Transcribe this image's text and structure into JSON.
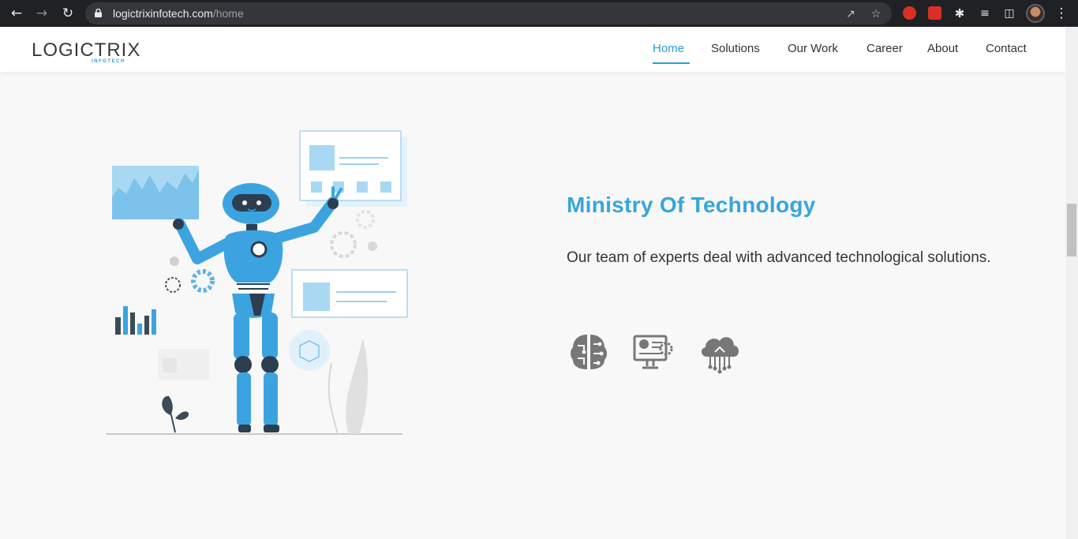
{
  "browser": {
    "url_domain": "logictrixinfotech.com",
    "url_path": "/home"
  },
  "site": {
    "logo_text": "LOGICTRIX",
    "logo_sub": "INFOTECH",
    "nav": [
      {
        "label": "Home",
        "active": true
      },
      {
        "label": "Solutions",
        "active": false
      },
      {
        "label": "Our Work",
        "active": false
      },
      {
        "label": "Career",
        "active": false
      },
      {
        "label": "About",
        "active": false
      },
      {
        "label": "Contact",
        "active": false
      }
    ]
  },
  "hero": {
    "title": "Ministry Of Technology",
    "description": "Our team of experts deal with advanced technological solutions.",
    "features": [
      "brain-circuit-icon",
      "ai-computer-icon",
      "cloud-network-icon"
    ]
  },
  "colors": {
    "accent": "#36a6dd",
    "robot_blue": "#3ba4e0",
    "icon_gray": "#777777",
    "chrome_bg": "#202124"
  }
}
